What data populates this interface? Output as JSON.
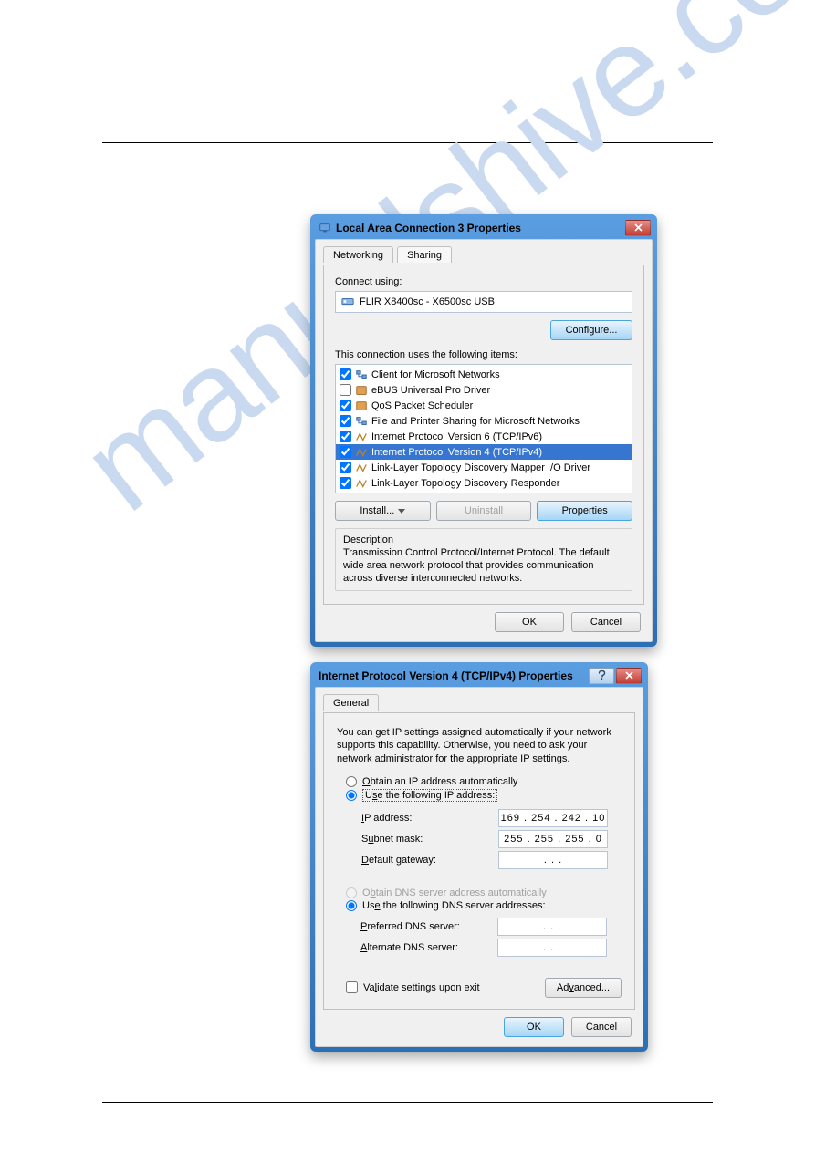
{
  "watermark": "manualshive.com",
  "dialog1": {
    "title": "Local Area Connection 3 Properties",
    "tabs": {
      "networking": "Networking",
      "sharing": "Sharing"
    },
    "connect_using_label": "Connect using:",
    "adapter": "FLIR X8400sc - X6500sc USB",
    "configure_btn": "Configure...",
    "items_label": "This connection uses the following items:",
    "items": [
      {
        "checked": true,
        "label": "Client for Microsoft Networks"
      },
      {
        "checked": false,
        "label": "eBUS Universal Pro Driver"
      },
      {
        "checked": true,
        "label": "QoS Packet Scheduler"
      },
      {
        "checked": true,
        "label": "File and Printer Sharing for Microsoft Networks"
      },
      {
        "checked": true,
        "label": "Internet Protocol Version 6 (TCP/IPv6)"
      },
      {
        "checked": true,
        "label": "Internet Protocol Version 4 (TCP/IPv4)",
        "selected": true
      },
      {
        "checked": true,
        "label": "Link-Layer Topology Discovery Mapper I/O Driver"
      },
      {
        "checked": true,
        "label": "Link-Layer Topology Discovery Responder"
      }
    ],
    "install_btn": "Install...",
    "uninstall_btn": "Uninstall",
    "properties_btn": "Properties",
    "desc_title": "Description",
    "desc_text": "Transmission Control Protocol/Internet Protocol. The default wide area network protocol that provides communication across diverse interconnected networks.",
    "ok": "OK",
    "cancel": "Cancel"
  },
  "dialog2": {
    "title": "Internet Protocol Version 4 (TCP/IPv4) Properties",
    "tab_general": "General",
    "intro": "You can get IP settings assigned automatically if your network supports this capability. Otherwise, you need to ask your network administrator for the appropriate IP settings.",
    "radio_auto_ip": "Obtain an IP address automatically",
    "radio_manual_ip": "Use the following IP address:",
    "ip_label": "IP address:",
    "ip_value": "169 . 254 . 242 . 10",
    "subnet_label": "Subnet mask:",
    "subnet_value": "255 . 255 . 255 . 0",
    "gateway_label": "Default gateway:",
    "gateway_value": ".     .     .",
    "radio_auto_dns": "Obtain DNS server address automatically",
    "radio_manual_dns": "Use the following DNS server addresses:",
    "pref_dns_label": "Preferred DNS server:",
    "pref_dns_value": ".     .     .",
    "alt_dns_label": "Alternate DNS server:",
    "alt_dns_value": ".     .     .",
    "validate_label": "Validate settings upon exit",
    "advanced_btn": "Advanced...",
    "ok": "OK",
    "cancel": "Cancel"
  }
}
